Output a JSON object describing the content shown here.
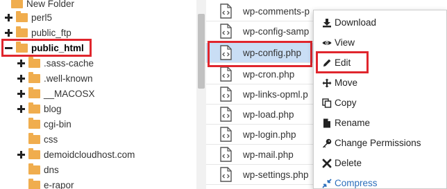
{
  "tree": {
    "items": [
      {
        "label": "New Folder",
        "toggle": "none",
        "bold": false
      },
      {
        "label": "perl5",
        "toggle": "plus",
        "bold": false
      },
      {
        "label": "public_ftp",
        "toggle": "plus",
        "bold": false
      },
      {
        "label": "public_html",
        "toggle": "minus",
        "bold": true
      },
      {
        "label": ".sass-cache",
        "toggle": "plus",
        "bold": false
      },
      {
        "label": ".well-known",
        "toggle": "plus",
        "bold": false
      },
      {
        "label": "__MACOSX",
        "toggle": "plus",
        "bold": false
      },
      {
        "label": "blog",
        "toggle": "plus",
        "bold": false
      },
      {
        "label": "cgi-bin",
        "toggle": "none",
        "bold": false
      },
      {
        "label": "css",
        "toggle": "none",
        "bold": false
      },
      {
        "label": "demoidcloudhost.com",
        "toggle": "plus",
        "bold": false
      },
      {
        "label": "dns",
        "toggle": "none",
        "bold": false
      },
      {
        "label": "e-rapor",
        "toggle": "none",
        "bold": false
      }
    ]
  },
  "files": {
    "items": [
      {
        "name": "wp-comments-p",
        "selected": false
      },
      {
        "name": "wp-config-samp",
        "selected": false
      },
      {
        "name": "wp-config.php",
        "selected": true
      },
      {
        "name": "wp-cron.php",
        "selected": false
      },
      {
        "name": "wp-links-opml.p",
        "selected": false
      },
      {
        "name": "wp-load.php",
        "selected": false
      },
      {
        "name": "wp-login.php",
        "selected": false
      },
      {
        "name": "wp-mail.php",
        "selected": false
      },
      {
        "name": "wp-settings.php",
        "selected": false
      }
    ]
  },
  "context_menu": {
    "items": [
      {
        "label": "Download",
        "icon": "download-icon"
      },
      {
        "label": "View",
        "icon": "eye-icon"
      },
      {
        "label": "Edit",
        "icon": "pencil-icon"
      },
      {
        "label": "Move",
        "icon": "move-arrows-icon"
      },
      {
        "label": "Copy",
        "icon": "copy-icon"
      },
      {
        "label": "Rename",
        "icon": "file-icon"
      },
      {
        "label": "Change Permissions",
        "icon": "key-icon"
      },
      {
        "label": "Delete",
        "icon": "delete-x-icon"
      },
      {
        "label": "Compress",
        "icon": "compress-icon"
      }
    ]
  },
  "colors": {
    "highlight": "#e0262d",
    "folder": "#f0ad4e",
    "selected_row": "#c9def5",
    "compress_text": "#2a6ebb"
  }
}
